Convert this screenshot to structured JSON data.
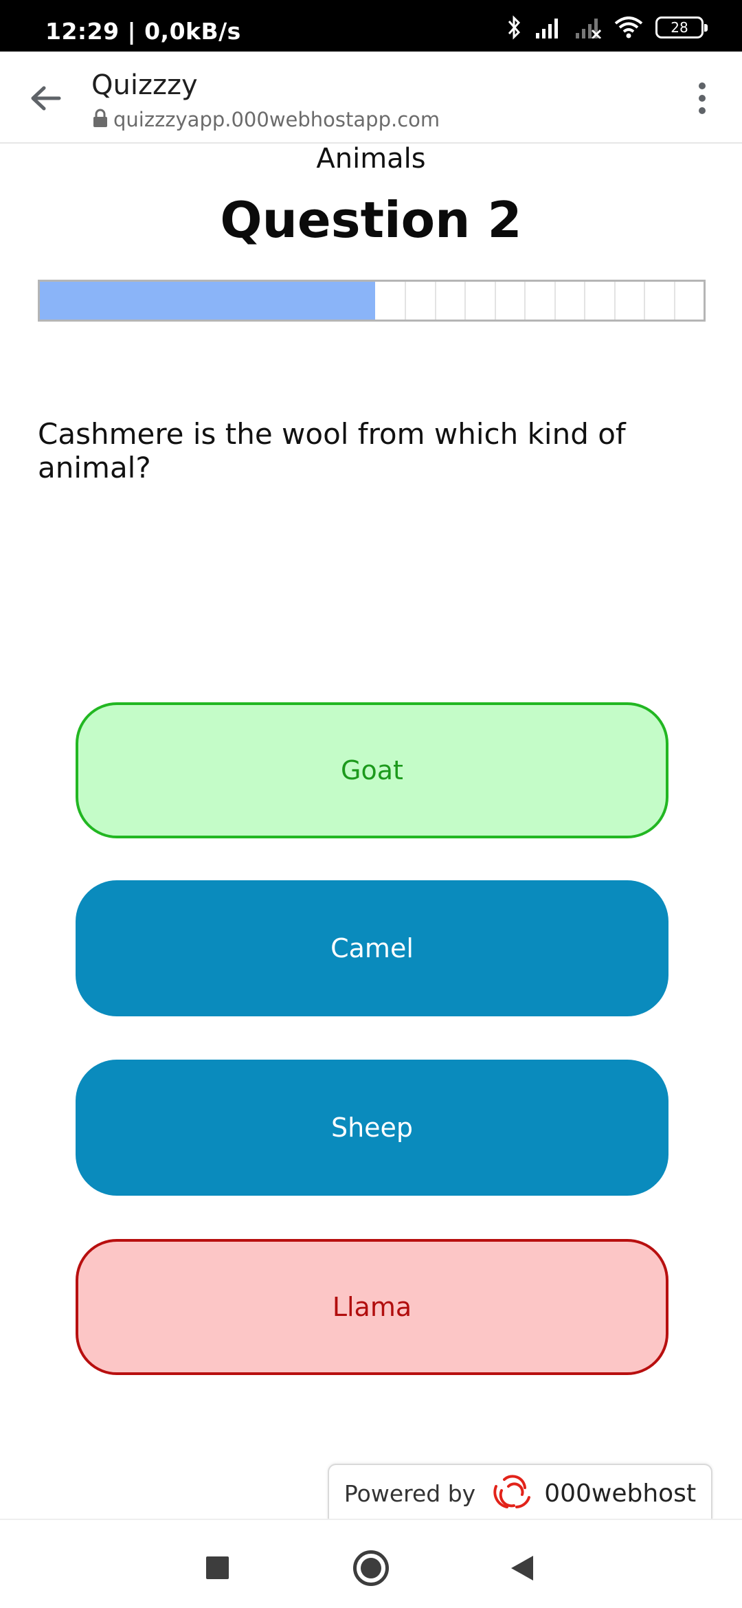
{
  "status_bar": {
    "time": "12:29 | 0,0kB/s",
    "battery": "28",
    "icons": [
      "bluetooth-icon",
      "signal-icon",
      "signal-off-icon",
      "wifi-icon",
      "battery-icon"
    ]
  },
  "browser": {
    "title": "Quizzzy",
    "url": "quizzzyapp.000webhostapp.com",
    "back_icon": "arrow-left-icon",
    "menu_icon": "more-vert-icon"
  },
  "quiz": {
    "category": "Animals",
    "heading": "Question 2",
    "progress_fraction": 0.505,
    "progress_segments": 10,
    "question": "Cashmere is the wool from which kind of animal?",
    "answers": [
      {
        "label": "Goat",
        "state": "correct"
      },
      {
        "label": "Camel",
        "state": "neutral"
      },
      {
        "label": "Sheep",
        "state": "neutral"
      },
      {
        "label": "Llama",
        "state": "wrong"
      }
    ]
  },
  "badge": {
    "powered_by": "Powered by",
    "brand": "000webhost"
  },
  "colors": {
    "progress_fill": "#8ab4f8",
    "answer_neutral": "#0a8bbd",
    "answer_correct_bg": "#c4fcc8",
    "answer_correct_border": "#22b722",
    "answer_wrong_bg": "#fcc6c6",
    "answer_wrong_border": "#b80f0f"
  }
}
